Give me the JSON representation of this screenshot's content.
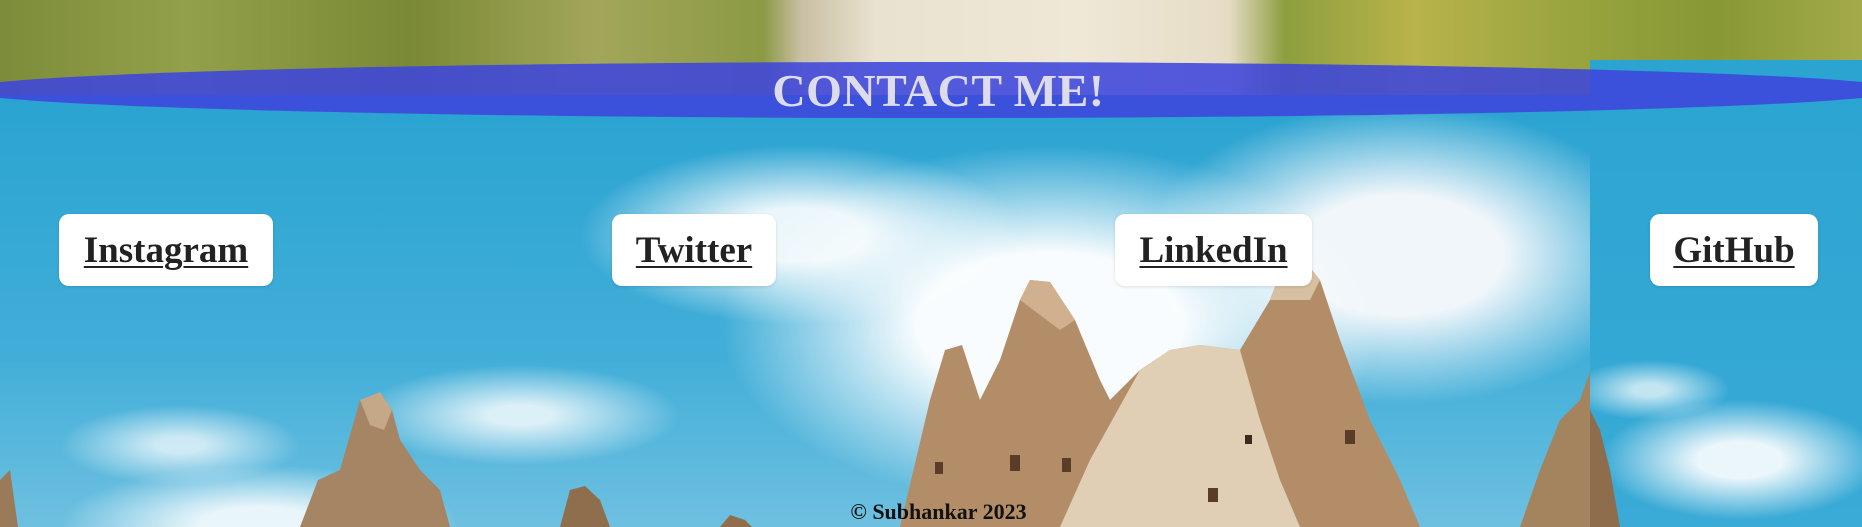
{
  "header": {
    "title": "CONTACT ME!"
  },
  "social_links": [
    {
      "label": "Instagram",
      "icon": "instagram"
    },
    {
      "label": "Twitter",
      "icon": "twitter"
    },
    {
      "label": "LinkedIn",
      "icon": "linkedin"
    },
    {
      "label": "GitHub",
      "icon": "github"
    }
  ],
  "footer": {
    "copyright": "© Subhankar 2023"
  },
  "colors": {
    "banner": "#3e46dc",
    "banner_text": "#dcdcec",
    "card_background": "#ffffff",
    "link_text": "#222222"
  }
}
